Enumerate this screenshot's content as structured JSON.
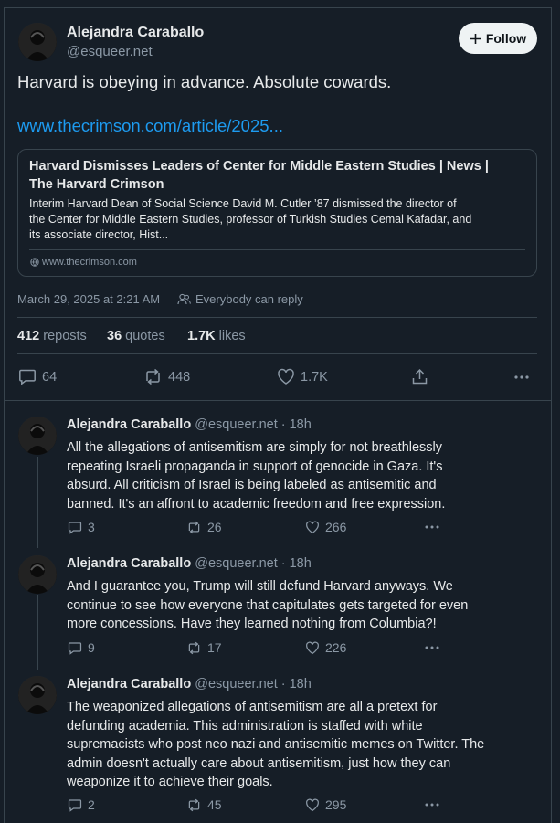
{
  "main_tweet": {
    "author_name": "Alejandra Caraballo",
    "author_handle": "@esqueer.net",
    "follow_label": "Follow",
    "text": "Harvard is obeying in advance. Absolute cowards.",
    "link_text": "www.thecrimson.com/article/2025...",
    "card": {
      "title_line1": "Harvard Dismisses Leaders of Center for Middle Eastern Studies | News |",
      "title_line2": "The Harvard Crimson",
      "desc_line1": "Interim Harvard Dean of Social Science David M. Cutler ’87 dismissed the director of",
      "desc_line2": "the Center for Middle Eastern Studies, professor of Turkish Studies Cemal Kafadar, and",
      "desc_line3": "its associate director, Hist...",
      "domain": "www.thecrimson.com"
    },
    "timestamp": "March 29, 2025 at 2:21 AM",
    "reply_setting": "Everybody can reply",
    "stats": {
      "reposts_count": "412",
      "reposts_label": "reposts",
      "quotes_count": "36",
      "quotes_label": "quotes",
      "likes_count": "1.7K",
      "likes_label": "likes"
    },
    "actions": {
      "replies": "64",
      "reposts": "448",
      "likes": "1.7K"
    }
  },
  "replies": [
    {
      "author_name": "Alejandra Caraballo",
      "author_handle": "@esqueer.net",
      "time": "· 18h",
      "lines": [
        "All the allegations of antisemitism are simply for not breathlessly",
        "repeating Israeli propaganda in support of genocide in Gaza. It's",
        "absurd. All criticism of Israel is being labeled as antisemitic and",
        "banned. It's an affront to academic freedom and free expression."
      ],
      "replies": "3",
      "reposts": "26",
      "likes": "266"
    },
    {
      "author_name": "Alejandra Caraballo",
      "author_handle": "@esqueer.net",
      "time": "· 18h",
      "lines": [
        "And I guarantee you, Trump will still defund Harvard anyways. We",
        "continue to see how everyone that capitulates gets targeted for even",
        "more concessions. Have they learned nothing from Columbia?!"
      ],
      "replies": "9",
      "reposts": "17",
      "likes": "226"
    },
    {
      "author_name": "Alejandra Caraballo",
      "author_handle": "@esqueer.net",
      "time": "· 18h",
      "lines": [
        "The weaponized allegations of antisemitism are all a pretext for",
        "defunding academia. This administration is staffed with white",
        "supremacists who post neo nazi and antisemitic memes on Twitter. The",
        "admin doesn't actually care about antisemitism, just how they can",
        "weaponize it to achieve their goals."
      ],
      "replies": "2",
      "reposts": "45",
      "likes": "295"
    }
  ],
  "colors": {
    "background": "#161e27",
    "border": "#38444d",
    "muted": "#8b98a5",
    "link": "#1d9bf0",
    "text": "#e7e9ea"
  },
  "icons": [
    "person-add-icon",
    "globe-icon",
    "people-icon",
    "reply-icon",
    "repost-icon",
    "like-icon",
    "share-icon",
    "more-icon"
  ]
}
